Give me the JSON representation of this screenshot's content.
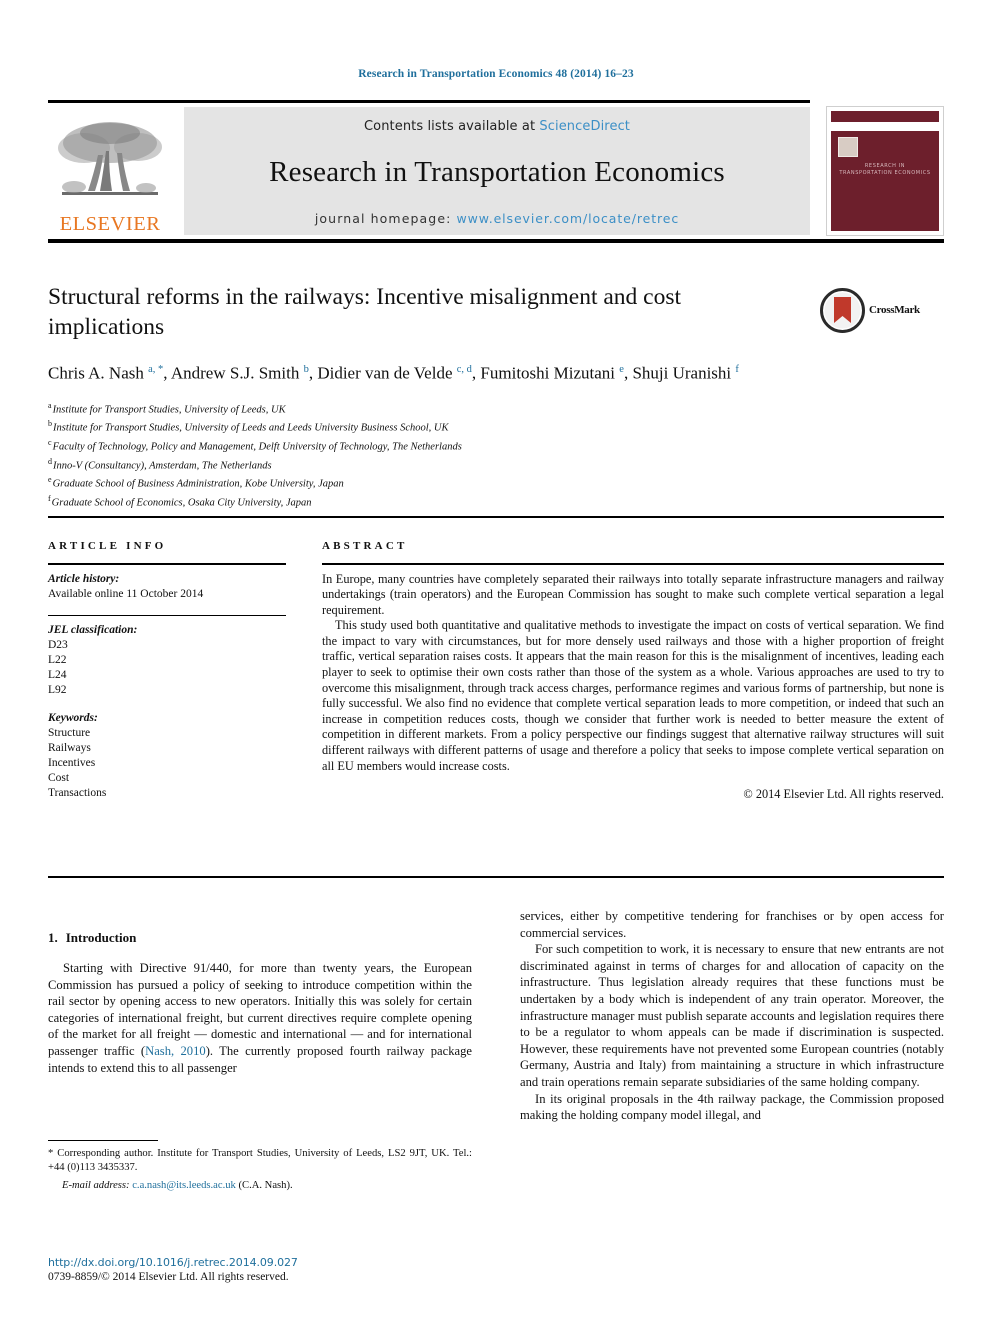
{
  "running_head": "Research in Transportation Economics 48 (2014) 16–23",
  "masthead": {
    "contents_prefix": "Contents lists available at ",
    "sciencedirect": "ScienceDirect",
    "journal_title": "Research in Transportation Economics",
    "homepage_label": "journal homepage: ",
    "homepage_url": "www.elsevier.com/locate/retrec",
    "publisher_wordmark": "ELSEVIER",
    "cover_title_line1": "RESEARCH IN",
    "cover_title_line2": "TRANSPORTATION ECONOMICS",
    "accent_blue": "#3c8fc6",
    "elsevier_orange": "#E87722",
    "cover_maroon": "#6d1f2c",
    "band_grey": "#e4e4e4"
  },
  "title": "Structural reforms in the railways: Incentive misalignment and cost implications",
  "crossmark_label": "CrossMark",
  "authors_html": "Chris A. Nash <sup>a, *</sup>, Andrew S.J. Smith <sup>b</sup>, Didier van de Velde <sup>c, d</sup>, Fumitoshi Mizutani <sup>e</sup>, Shuji Uranishi <sup>f</sup>",
  "affiliations": [
    {
      "mark": "a",
      "text": "Institute for Transport Studies, University of Leeds, UK"
    },
    {
      "mark": "b",
      "text": "Institute for Transport Studies, University of Leeds and Leeds University Business School, UK"
    },
    {
      "mark": "c",
      "text": "Faculty of Technology, Policy and Management, Delft University of Technology, The Netherlands"
    },
    {
      "mark": "d",
      "text": "Inno-V (Consultancy), Amsterdam, The Netherlands"
    },
    {
      "mark": "e",
      "text": "Graduate School of Business Administration, Kobe University, Japan"
    },
    {
      "mark": "f",
      "text": "Graduate School of Economics, Osaka City University, Japan"
    }
  ],
  "article_info": {
    "heading": "ARTICLE INFO",
    "history_label": "Article history:",
    "history_value": "Available online 11 October 2014",
    "jel_label": "JEL classification:",
    "jel_codes": [
      "D23",
      "L22",
      "L24",
      "L92"
    ],
    "keywords_label": "Keywords:",
    "keywords": [
      "Structure",
      "Railways",
      "Incentives",
      "Cost",
      "Transactions"
    ]
  },
  "abstract": {
    "heading": "ABSTRACT",
    "paragraph_1": "In Europe, many countries have completely separated their railways into totally separate infrastructure managers and railway undertakings (train operators) and the European Commission has sought to make such complete vertical separation a legal requirement.",
    "paragraph_2": "This study used both quantitative and qualitative methods to investigate the impact on costs of vertical separation. We find the impact to vary with circumstances, but for more densely used railways and those with a higher proportion of freight traffic, vertical separation raises costs. It appears that the main reason for this is the misalignment of incentives, leading each player to seek to optimise their own costs rather than those of the system as a whole. Various approaches are used to try to overcome this misalignment, through track access charges, performance regimes and various forms of partnership, but none is fully successful. We also find no evidence that complete vertical separation leads to more competition, or indeed that such an increase in competition reduces costs, though we consider that further work is needed to better measure the extent of competition in different markets. From a policy perspective our findings suggest that alternative railway structures will suit different railways with different patterns of usage and therefore a policy that seeks to impose complete vertical separation on all EU members would increase costs.",
    "copyright": "© 2014 Elsevier Ltd. All rights reserved."
  },
  "body": {
    "section_number": "1.",
    "section_title": "Introduction",
    "left_paragraph_1_a": "Starting with Directive 91/440, for more than twenty years, the European Commission has pursued a policy of seeking to introduce competition within the rail sector by opening access to new operators. Initially this was solely for certain categories of international freight, but current directives require complete opening of the market for all freight — domestic and international — and for international passenger traffic (",
    "left_paragraph_1_ref": "Nash, 2010",
    "left_paragraph_1_b": "). The currently proposed fourth railway package intends to extend this to all passenger",
    "right_paragraph_1": "services, either by competitive tendering for franchises or by open access for commercial services.",
    "right_paragraph_2": "For such competition to work, it is necessary to ensure that new entrants are not discriminated against in terms of charges for and allocation of capacity on the infrastructure. Thus legislation already requires that these functions must be undertaken by a body which is independent of any train operator. Moreover, the infrastructure manager must publish separate accounts and legislation requires there to be a regulator to whom appeals can be made if discrimination is suspected. However, these requirements have not prevented some European countries (notably Germany, Austria and Italy) from maintaining a structure in which infrastructure and train operations remain separate subsidiaries of the same holding company.",
    "right_paragraph_3": "In its original proposals in the 4th railway package, the Commission proposed making the holding company model illegal, and"
  },
  "footnotes": {
    "corresponding": "* Corresponding author. Institute for Transport Studies, University of Leeds, LS2 9JT, UK. Tel.: +44 (0)113 3435337.",
    "email_label": "E-mail address:",
    "email": "c.a.nash@its.leeds.ac.uk",
    "email_suffix": " (C.A. Nash)."
  },
  "footer": {
    "doi": "http://dx.doi.org/10.1016/j.retrec.2014.09.027",
    "issn_line": "0739-8859/© 2014 Elsevier Ltd. All rights reserved."
  }
}
